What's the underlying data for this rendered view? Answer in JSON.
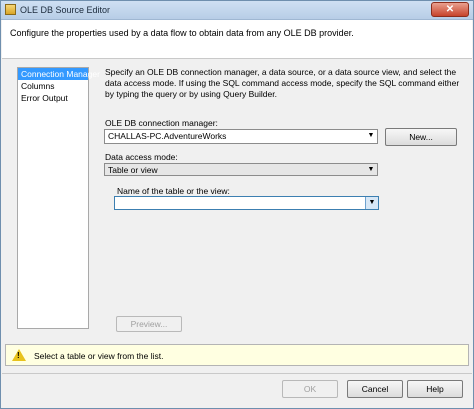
{
  "window": {
    "title": "OLE DB Source Editor",
    "close_glyph": "✕"
  },
  "header": {
    "description": "Configure the properties used by a data flow to obtain data from any OLE DB provider."
  },
  "nav": {
    "items": [
      {
        "label": "Connection Manager",
        "selected": true
      },
      {
        "label": "Columns",
        "selected": false
      },
      {
        "label": "Error Output",
        "selected": false
      }
    ]
  },
  "main": {
    "description": "Specify an OLE DB connection manager, a data source, or a data source view, and select the data access mode. If using the SQL command access mode, specify the SQL command either by typing the query or by using Query Builder.",
    "connection_label": "OLE DB connection manager:",
    "connection_value": "CHALLAS-PC.AdventureWorks",
    "new_button": "New...",
    "access_mode_label": "Data access mode:",
    "access_mode_value": "Table or view",
    "table_label": "Name of the table or the view:",
    "table_value": "",
    "preview_button": "Preview..."
  },
  "status": {
    "icon": "warning-icon",
    "message": "Select a table or view from the list."
  },
  "footer": {
    "ok_label": "OK",
    "cancel_label": "Cancel",
    "help_label": "Help"
  }
}
